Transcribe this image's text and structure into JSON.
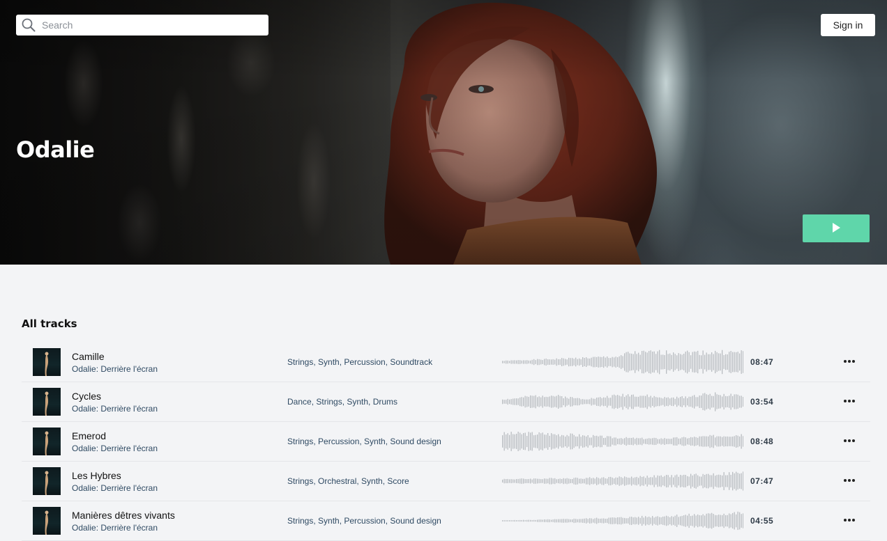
{
  "header": {
    "search_placeholder": "Search",
    "signin_label": "Sign in"
  },
  "hero": {
    "artist_name": "Odalie",
    "play_button_icon": "play-icon",
    "play_button_color": "#5fd6aa"
  },
  "tracks_section": {
    "title": "All tracks",
    "tracks": [
      {
        "name": "Camille",
        "album": "Odalie: Derrière l'écran",
        "tags": "Strings, Synth, Percussion, Soundtrack",
        "duration": "08:47"
      },
      {
        "name": "Cycles",
        "album": "Odalie: Derrière l'écran",
        "tags": "Dance, Strings, Synth, Drums",
        "duration": "03:54"
      },
      {
        "name": "Emerod",
        "album": "Odalie: Derrière l'écran",
        "tags": "Strings, Percussion, Synth, Sound design",
        "duration": "08:48"
      },
      {
        "name": "Les Hybres",
        "album": "Odalie: Derrière l'écran",
        "tags": "Strings, Orchestral, Synth, Score",
        "duration": "07:47"
      },
      {
        "name": "Manières dêtres vivants",
        "album": "Odalie: Derrière l'écran",
        "tags": "Strings, Synth, Percussion, Sound design",
        "duration": "04:55"
      }
    ]
  },
  "icons": {
    "search": "search-icon",
    "play": "play-icon",
    "more": "more-options-icon"
  },
  "colors": {
    "accent": "#5fd6aa",
    "background": "#f3f4f6",
    "waveform": "#b8bcc0"
  }
}
